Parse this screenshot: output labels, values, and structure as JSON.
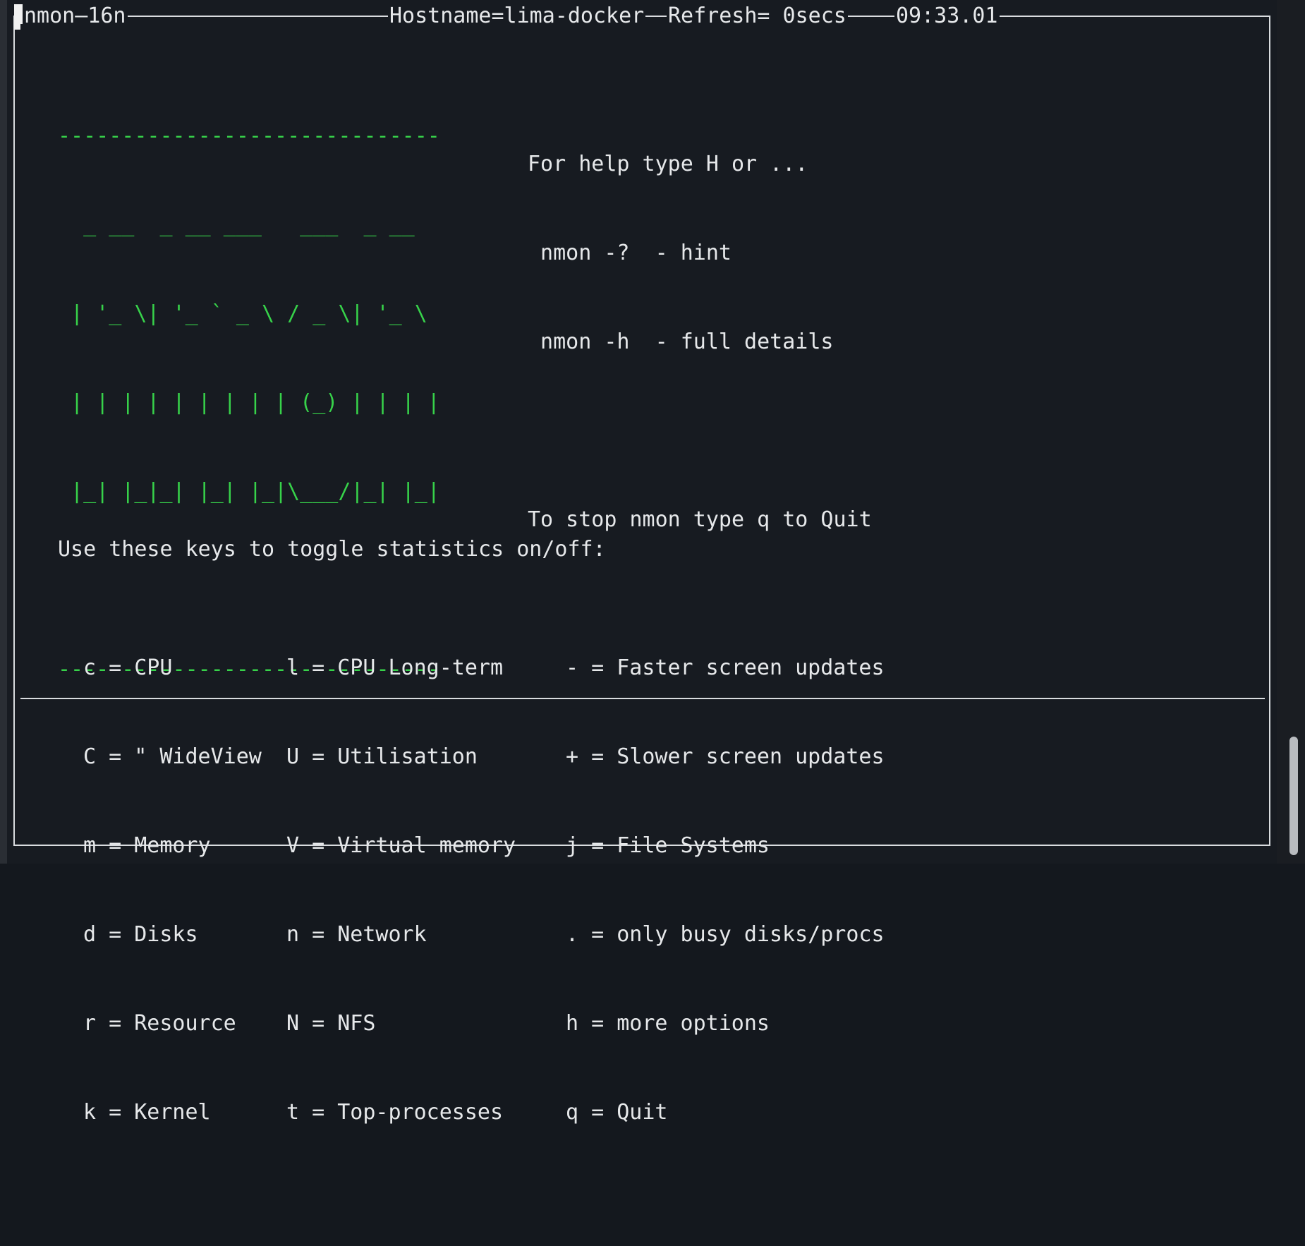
{
  "header": {
    "app": "nmon—16n",
    "hostname": "Hostname=lima-docker",
    "refresh": "Refresh= 0secs",
    "time": "09:33.01"
  },
  "logo": {
    "lines": [
      "------------------------------",
      "  _ __  _ __ ___   ___  _ __  ",
      " | '_ \\| '_ ` _ \\ / _ \\| '_ \\ ",
      " | | | | | | | | | (_) | | | |",
      " |_| |_|_| |_| |_|\\___/|_| |_|",
      "",
      "------------------------------"
    ]
  },
  "help": {
    "line1": "For help type H or ...",
    "line2": " nmon -?  - hint",
    "line3": " nmon -h  - full details",
    "line4": "",
    "line5": "To stop nmon type q to Quit"
  },
  "keys": {
    "heading": "Use these keys to toggle statistics on/off:",
    "rows": [
      [
        "c = CPU",
        "l = CPU Long-term",
        "- = Faster screen updates"
      ],
      [
        "C = \" WideView",
        "U = Utilisation",
        "+ = Slower screen updates"
      ],
      [
        "m = Memory",
        "V = Virtual memory",
        "j = File Systems"
      ],
      [
        "d = Disks",
        "n = Network",
        ". = only busy disks/procs"
      ],
      [
        "r = Resource",
        "N = NFS",
        "h = more options"
      ],
      [
        "k = Kernel",
        "t = Top-processes",
        "q = Quit"
      ]
    ]
  },
  "colors": {
    "background": "#171b21",
    "text": "#e6e8ea",
    "logo": "#37d24a"
  }
}
